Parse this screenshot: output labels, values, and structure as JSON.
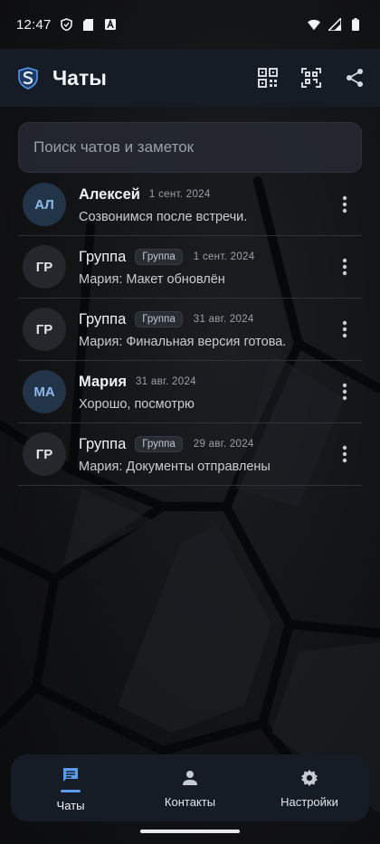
{
  "status_bar": {
    "time": "12:47"
  },
  "appbar": {
    "title": "Чаты"
  },
  "search": {
    "placeholder": "Поиск чатов и заметок"
  },
  "chats": [
    {
      "initials": "АЛ",
      "name": "Алексей",
      "is_group": false,
      "tag": "",
      "date": "1 сент. 2024",
      "preview": "Созвонимся после встречи."
    },
    {
      "initials": "ГР",
      "name": "Группа",
      "is_group": true,
      "tag": "Группа",
      "date": "1 сент. 2024",
      "preview": "Мария: Макет обновлён"
    },
    {
      "initials": "ГР",
      "name": "Группа",
      "is_group": true,
      "tag": "Группа",
      "date": "31 авг. 2024",
      "preview": "Мария: Финальная версия готова."
    },
    {
      "initials": "МА",
      "name": "Мария",
      "is_group": false,
      "tag": "",
      "date": "31 авг. 2024",
      "preview": "Хорошо, посмотрю"
    },
    {
      "initials": "ГР",
      "name": "Группа",
      "is_group": true,
      "tag": "Группа",
      "date": "29 авг. 2024",
      "preview": "Мария: Документы отправлены"
    }
  ],
  "bottom_nav": {
    "items": [
      {
        "label": "Чаты",
        "icon": "chat-icon",
        "active": true
      },
      {
        "label": "Контакты",
        "icon": "person-icon",
        "active": false
      },
      {
        "label": "Настройки",
        "icon": "gear-icon",
        "active": false
      }
    ]
  },
  "colors": {
    "background": "#121316",
    "appbar": "#161c26",
    "accent": "#5b9cf0",
    "avatar_blue_bg": "#223448",
    "avatar_blue_fg": "#8fb8ea"
  }
}
